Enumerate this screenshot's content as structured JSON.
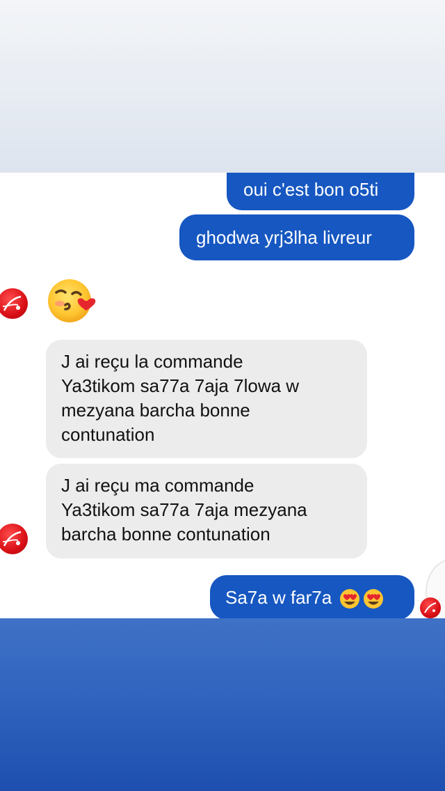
{
  "messages": {
    "out_1": "oui c'est bon o5ti",
    "out_2": "ghodwa yrj3lha livreur",
    "in_1": [
      "J ai reçu la commande",
      "Ya3tikom sa77a 7aja 7lowa w",
      "mezyana barcha bonne",
      "contunation"
    ],
    "in_2": [
      "J ai reçu ma commande",
      "Ya3tikom sa77a 7aja mezyana",
      "barcha  bonne contunation"
    ],
    "out_3": "Sa7a w far7a"
  },
  "icons": {
    "kiss": "face-blowing-kiss-emoji",
    "heart_eyes": "smiling-face-with-heart-eyes-emoji",
    "avatar": "red-logo-avatar"
  },
  "colors": {
    "outgoing_bubble": "#1657c1",
    "incoming_bubble": "#ececec",
    "avatar": "#d90f16"
  }
}
